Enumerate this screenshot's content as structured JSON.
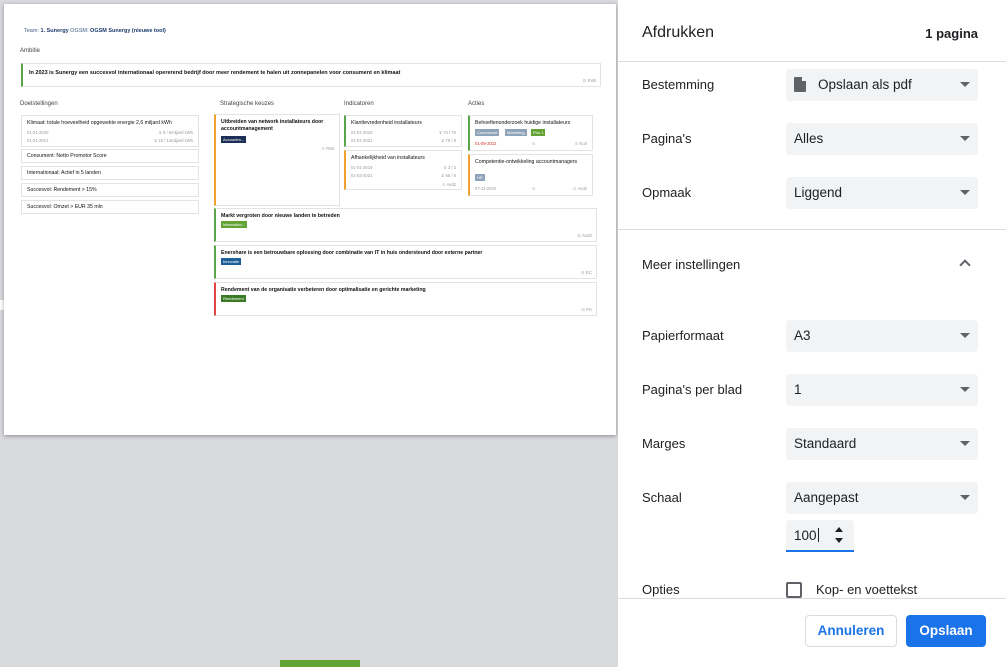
{
  "preview": {
    "team_prefix": "Team:",
    "team_name": "1. Sunergy",
    "ogsm_prefix": "OGSM:",
    "ogsm_name": "OGSM Sunergy (nieuwe tool)",
    "ambition_label": "Ambitie",
    "ambition_text": "In 2023 is Sunergy een succesvol internationaal opererend bedrijf door meer rendement te halen uit zonnepanelen voor consument en klimaat",
    "ambition_owner": "RvB",
    "columns": [
      "Doelstellingen",
      "Strategische keuzes",
      "Indicatoren",
      "Acties"
    ],
    "goals": [
      {
        "title": "Klimaat: totale hoeveelheid opgewekte energie 2,6 miljard kWh",
        "date1": "01-01-2020",
        "val1": "8 / 6miljard kWh",
        "date2": "01-01-2021",
        "val2": "15 / 12miljard kWh"
      },
      {
        "title": "Consument: Netto Promotor Score"
      },
      {
        "title": "Internationaal: Actief in 5 landen"
      },
      {
        "title": "Succesvol: Rendement > 15%"
      },
      {
        "title": "Succesvol: Omzet > EUR 35 mln"
      }
    ],
    "strategies": [
      {
        "title": "Uitbreiden van network installateurs door accountmanagement",
        "tag": "Accountm...",
        "owner": "RvB"
      },
      {
        "title": "Markt vergroten door nieuwe landen te betreden",
        "tag": "Internation...",
        "owner": "Avd2"
      },
      {
        "title": "Enershare is een betrouwbare oplossing door combinatie van IT in huis ondersteund door externe partner",
        "tag": "Innovatie",
        "owner": "EC"
      },
      {
        "title": "Rendement van de organisatie verbeteren door optimalisatie en gerichte marketing",
        "tag": "Rendement",
        "owner": "FK"
      }
    ],
    "indicators": [
      {
        "title": "Klanttevredenheid installateurs",
        "date1": "01-01-2019",
        "val1": "74 / 75",
        "date2": "01-01-2021",
        "val2": "79 / 8"
      },
      {
        "title": "Afhankelijkheid van installateurs",
        "date1": "01-01-2019",
        "val1": "3 / 3",
        "date2": "01-03-2021",
        "val2": "65 / 8",
        "owner": "Avd2"
      }
    ],
    "actions": [
      {
        "title": "Behoeftenonderzoek huidige installateurs",
        "tags": [
          "Commercie",
          "Marketing",
          "Prio 1"
        ],
        "date": "01-08-2022",
        "owner": "Ko3"
      },
      {
        "title": "Competentie-ontwikkeling accountmanagers",
        "tags": [
          "HR"
        ],
        "date": "07-11-2022",
        "owner": "Avd2"
      }
    ]
  },
  "panel": {
    "title": "Afdrukken",
    "pages_count": "1 pagina",
    "destination_label": "Bestemming",
    "destination_value": "Opslaan als pdf",
    "pages_label": "Pagina's",
    "pages_value": "Alles",
    "layout_label": "Opmaak",
    "layout_value": "Liggend",
    "more_settings_label": "Meer instellingen",
    "paper_label": "Papierformaat",
    "paper_value": "A3",
    "per_sheet_label": "Pagina's per blad",
    "per_sheet_value": "1",
    "margins_label": "Marges",
    "margins_value": "Standaard",
    "scale_label": "Schaal",
    "scale_value": "Aangepast",
    "scale_number": "100",
    "options_label": "Opties",
    "header_footer_label": "Kop- en voettekst",
    "cancel_label": "Annuleren",
    "save_label": "Opslaan"
  },
  "colors": {
    "accent": "#1a73e8",
    "green_border": "#5aa54a",
    "orange_border": "#f0a030",
    "red_border": "#e04646",
    "tag_navy": "#1b2f55",
    "tag_green": "#63a335",
    "tag_blue": "#1d5f9a",
    "tag_darkgreen": "#3b7a24",
    "tag_grey": "#8fa3b8"
  }
}
